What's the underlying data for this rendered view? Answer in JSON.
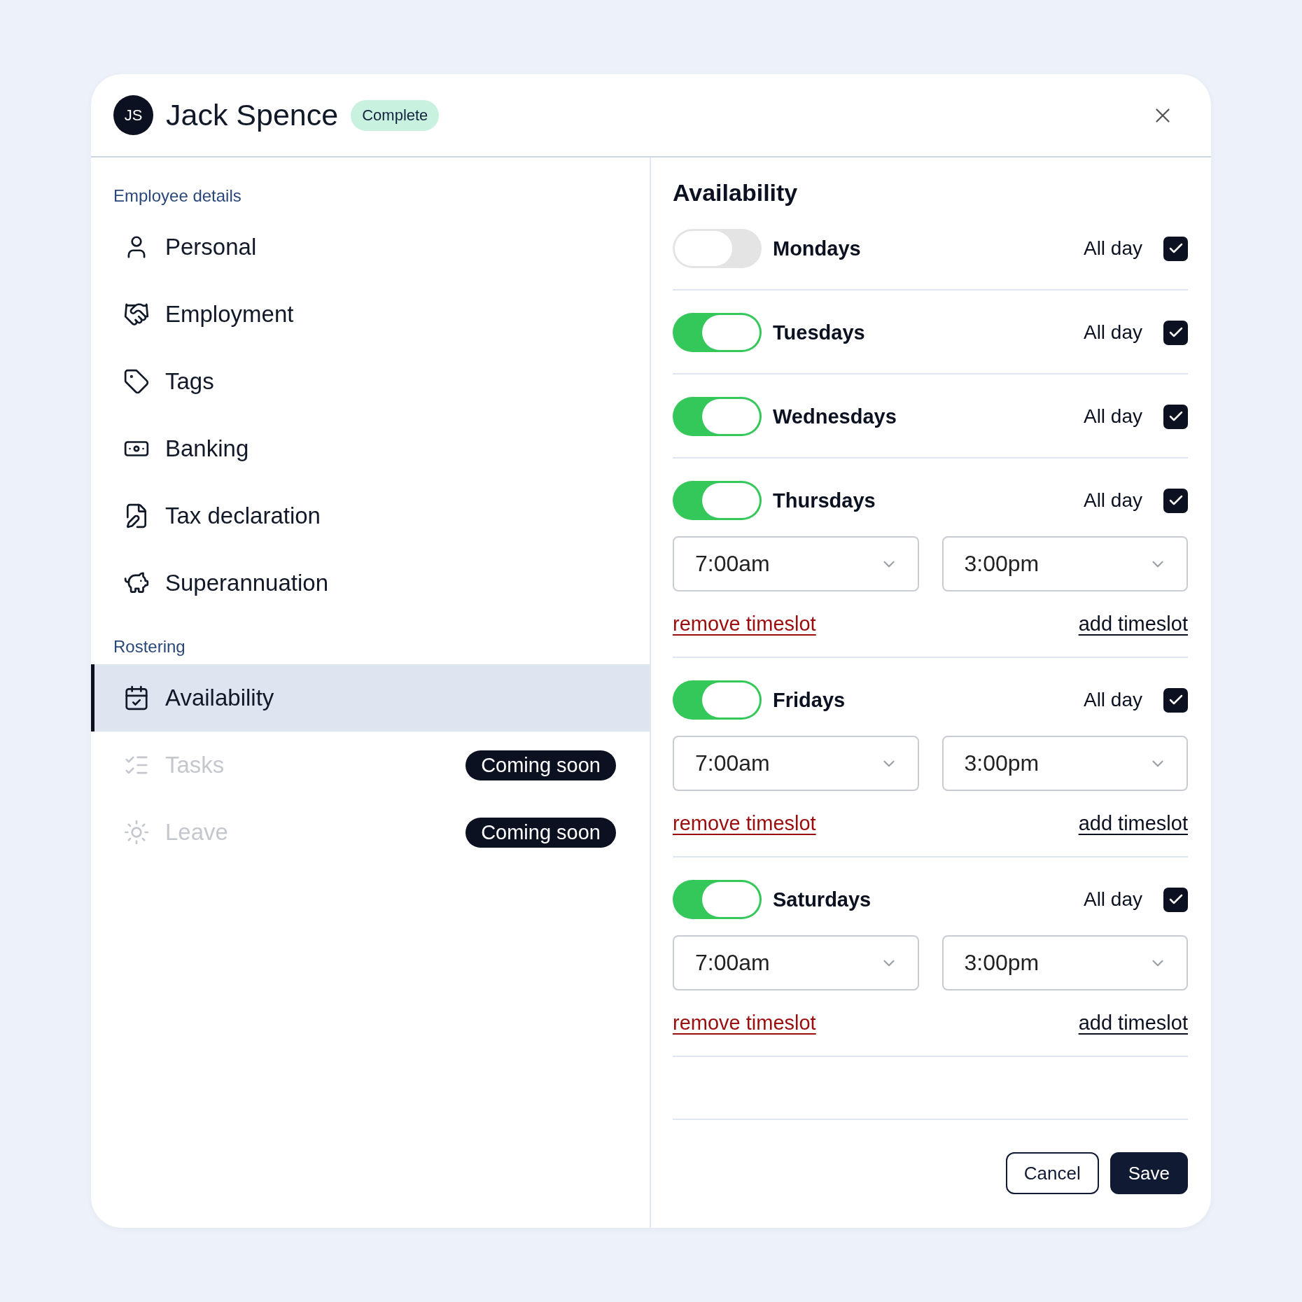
{
  "header": {
    "initials": "JS",
    "name": "Jack Spence",
    "status": "Complete"
  },
  "sidebar": {
    "sections": [
      {
        "title": "Employee details",
        "items": [
          {
            "label": "Personal",
            "selected": false,
            "disabled": false
          },
          {
            "label": "Employment",
            "selected": false,
            "disabled": false
          },
          {
            "label": "Tags",
            "selected": false,
            "disabled": false
          },
          {
            "label": "Banking",
            "selected": false,
            "disabled": false
          },
          {
            "label": "Tax declaration",
            "selected": false,
            "disabled": false
          },
          {
            "label": "Superannuation",
            "selected": false,
            "disabled": false
          }
        ]
      },
      {
        "title": "Rostering",
        "items": [
          {
            "label": "Availability",
            "selected": true,
            "disabled": false
          },
          {
            "label": "Tasks",
            "selected": false,
            "disabled": true,
            "badge": "Coming soon"
          },
          {
            "label": "Leave",
            "selected": false,
            "disabled": true,
            "badge": "Coming soon"
          }
        ]
      }
    ]
  },
  "availability": {
    "title": "Availability",
    "days": [
      {
        "label": "Mondays",
        "on": false,
        "all_day_label": "All day",
        "all_day": true
      },
      {
        "label": "Tuesdays",
        "on": true,
        "all_day_label": "All day",
        "all_day": true
      },
      {
        "label": "Wednesdays",
        "on": true,
        "all_day_label": "All day",
        "all_day": true
      },
      {
        "label": "Thursdays",
        "on": true,
        "all_day_label": "All day",
        "all_day": true,
        "timeslot": {
          "start": "7:00am",
          "end": "3:00pm",
          "remove": "remove timeslot",
          "add": "add timeslot"
        }
      },
      {
        "label": "Fridays",
        "on": true,
        "all_day_label": "All day",
        "all_day": true,
        "timeslot": {
          "start": "7:00am",
          "end": "3:00pm",
          "remove": "remove timeslot",
          "add": "add timeslot"
        }
      },
      {
        "label": "Saturdays",
        "on": true,
        "all_day_label": "All day",
        "all_day": true,
        "timeslot": {
          "start": "7:00am",
          "end": "3:00pm",
          "remove": "remove timeslot",
          "add": "add timeslot"
        }
      }
    ]
  },
  "buttons": {
    "cancel": "Cancel",
    "save": "Save"
  }
}
